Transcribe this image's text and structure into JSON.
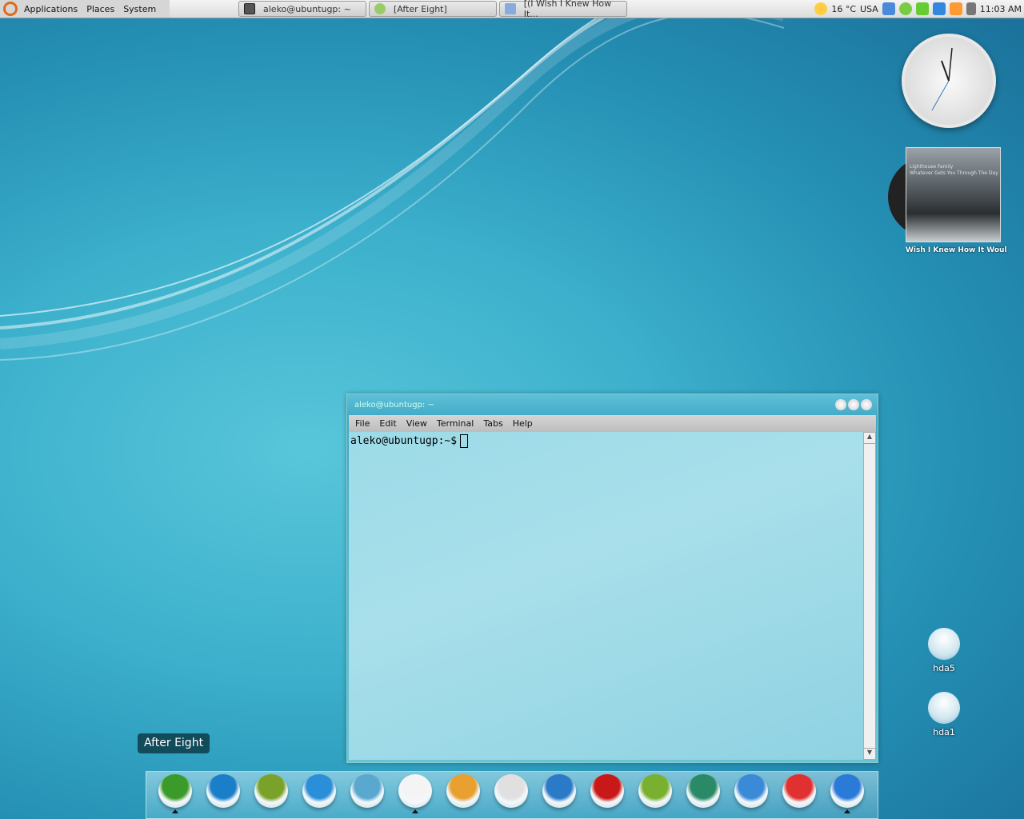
{
  "panel": {
    "menus": [
      "Applications",
      "Places",
      "System"
    ],
    "tasks": [
      {
        "label": "aleko@ubuntugp: ~",
        "icon": "terminal-icon"
      },
      {
        "label": "[After Eight]",
        "icon": "green-circle-icon"
      },
      {
        "label": "[(I Wish I Knew How It...",
        "icon": "media-player-icon"
      }
    ],
    "weather": "16 °C",
    "location": "USA",
    "clock": "11:03 AM"
  },
  "album": {
    "artist": "Lighthouse Family",
    "album": "Whatever Gets You Through The Day",
    "caption": "Wish I Knew How It Woul"
  },
  "desktop": {
    "drives": [
      "hda5",
      "hda1"
    ]
  },
  "terminal": {
    "title": "aleko@ubuntugp: ~",
    "menu": [
      "File",
      "Edit",
      "View",
      "Terminal",
      "Tabs",
      "Help"
    ],
    "prompt": "aleko@ubuntugp:~$"
  },
  "tooltip": "After Eight",
  "dock": {
    "items": [
      {
        "icon": "icq-icon",
        "color": "#3a9a2a",
        "running": true
      },
      {
        "icon": "globe-icon",
        "color": "#1a7fc8",
        "running": false
      },
      {
        "icon": "settings-gear-icon",
        "color": "#7aa22a",
        "running": false
      },
      {
        "icon": "internet-globe-icon",
        "color": "#2a8fd8",
        "running": false
      },
      {
        "icon": "wallpaper-icon",
        "color": "#5aa8d0",
        "running": false
      },
      {
        "icon": "blank-app-icon",
        "color": "#f4f4f4",
        "running": true
      },
      {
        "icon": "mail-icon",
        "color": "#e8a030",
        "running": false
      },
      {
        "icon": "telescope-icon",
        "color": "#e0e0e0",
        "running": false
      },
      {
        "icon": "video-icon",
        "color": "#2a7ac8",
        "running": false
      },
      {
        "icon": "flame-icon",
        "color": "#c81818",
        "running": false
      },
      {
        "icon": "notes-icon",
        "color": "#7ab030",
        "running": false
      },
      {
        "icon": "feather-icon",
        "color": "#2a8a68",
        "running": false
      },
      {
        "icon": "screen-download-icon",
        "color": "#3a8ad8",
        "running": false
      },
      {
        "icon": "heart-icon",
        "color": "#e03030",
        "running": false
      },
      {
        "icon": "music-icon",
        "color": "#2a7ad8",
        "running": true
      }
    ]
  }
}
